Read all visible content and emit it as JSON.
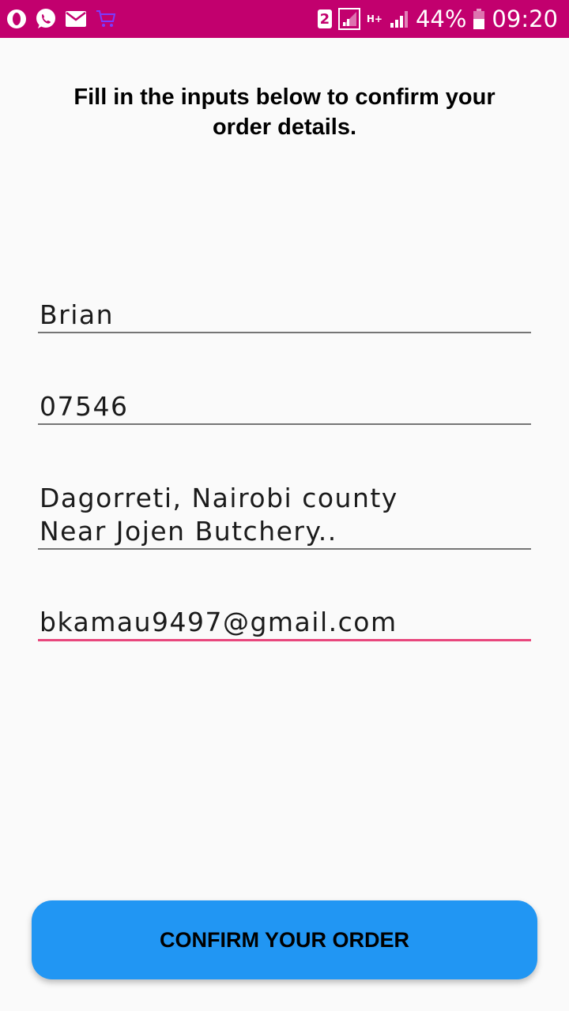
{
  "status_bar": {
    "background": "#c2006e",
    "left_icons": [
      "opera-icon",
      "whatsapp-icon",
      "email-icon",
      "shopping-cart-icon"
    ],
    "sim_slot": "2",
    "network_type": "H+",
    "battery_percent": "44%",
    "time": "09:20"
  },
  "form": {
    "title": "Fill in the inputs below to confirm your order details.",
    "fields": [
      {
        "value": "Brian"
      },
      {
        "value": "07546"
      },
      {
        "value": "Dagorreti, Nairobi county\nNear Jojen Butchery.."
      },
      {
        "value": "bkamau9497@gmail.com",
        "focused": true
      }
    ],
    "accent_color": "#e8467c"
  },
  "confirm_button": {
    "label": "CONFIRM YOUR ORDER",
    "color": "#2196f3"
  }
}
